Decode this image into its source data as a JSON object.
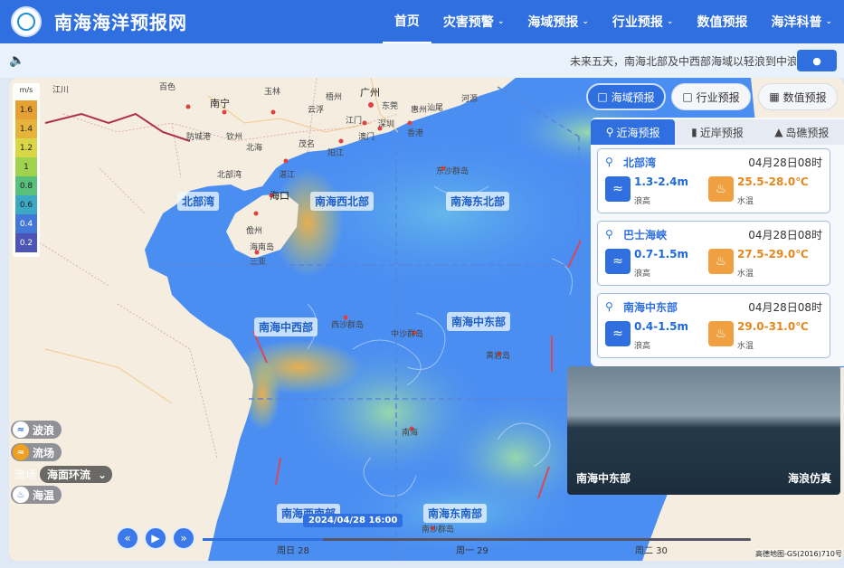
{
  "header": {
    "title": "南海海洋预报网",
    "nav": [
      {
        "label": "首页",
        "dropdown": false,
        "active": true
      },
      {
        "label": "灾害预警",
        "dropdown": true
      },
      {
        "label": "海域预报",
        "dropdown": true
      },
      {
        "label": "行业预报",
        "dropdown": true
      },
      {
        "label": "数值预报",
        "dropdown": false
      },
      {
        "label": "海洋科普",
        "dropdown": true
      }
    ]
  },
  "notice": {
    "text": "未来五天，南海北部及中西部海域以轻浪到中浪"
  },
  "legend": {
    "unit": "m/s",
    "values": [
      "1.6",
      "1.4",
      "1.2",
      "1",
      "0.8",
      "0.6",
      "0.4",
      "0.2"
    ],
    "colors": [
      "#e6a033",
      "#e7b43b",
      "#d9d745",
      "#9fd34d",
      "#58c07a",
      "#3ba8c4",
      "#4478d8",
      "#4c55b5"
    ]
  },
  "map": {
    "regions": [
      "北部湾",
      "南海西北部",
      "南海东北部",
      "南海中西部",
      "南海中东部",
      "南海西南部",
      "南海东南部"
    ],
    "cities": [
      "百色",
      "南宁",
      "玉林",
      "梧州",
      "广州",
      "东莞",
      "惠州",
      "深圳",
      "香港",
      "澳门",
      "湛江",
      "茂名",
      "阳江",
      "海口",
      "儋州",
      "三亚",
      "海南岛",
      "北部湾",
      "东沙群岛",
      "西沙群岛",
      "中沙群岛",
      "黄岩岛",
      "南沙群岛",
      "南海",
      "江川",
      "云浮",
      "江门",
      "汕尾",
      "河源",
      "北海",
      "防城港",
      "钦州"
    ],
    "copyright": "高德地图-GS(2016)710号"
  },
  "layers": {
    "wave": "波浪",
    "current": "流场",
    "temp": "海温",
    "flow_label": "流场",
    "flow_select": "海面环流"
  },
  "top_tabs": [
    "海域预报",
    "行业预报",
    "数值预报"
  ],
  "sub_tabs": [
    "近海预报",
    "近岸预报",
    "岛礁预报"
  ],
  "cards": [
    {
      "name": "北部湾",
      "time": "04月28日08时",
      "wave": "1.3-2.4m",
      "wave_label": "浪高",
      "temp": "25.5-28.0℃",
      "temp_label": "水温"
    },
    {
      "name": "巴士海峡",
      "time": "04月28日08时",
      "wave": "0.7-1.5m",
      "wave_label": "浪高",
      "temp": "27.5-29.0℃",
      "temp_label": "水温"
    },
    {
      "name": "南海中东部",
      "time": "04月28日08时",
      "wave": "0.4-1.5m",
      "wave_label": "浪高",
      "temp": "29.0-31.0℃",
      "temp_label": "水温"
    }
  ],
  "simulation": {
    "location": "南海中东部",
    "label": "海浪仿真"
  },
  "timeline": {
    "current": "2024/04/28 16:00",
    "days": [
      "周日 28",
      "周一 29",
      "周二 30"
    ],
    "progress": 0.22
  },
  "colors": {
    "accent": "#2f6fe0",
    "header": "#2f6fe0",
    "warm": "#f0a040"
  }
}
